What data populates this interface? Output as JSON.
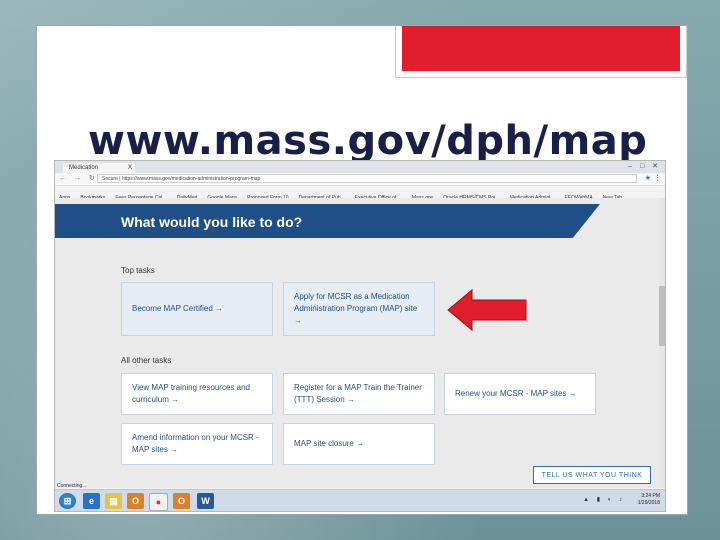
{
  "slide": {
    "title": "www.mass.gov/dph/map"
  },
  "browser": {
    "tab_title": "Medication Administrati...",
    "tab_close": "X",
    "window_controls": "– □ ✕",
    "nav_buttons": "← → ↻ ⌂",
    "url": "Secure | https://www.mass.gov/medication-administration-program-map",
    "bookmarks": [
      "Apps",
      "Bookmarks",
      "Fees Percentage Cal...",
      "DailyMed",
      "Google Maps",
      "Proposed Form 10",
      "Department of Pub...",
      "Executive Office of ...",
      "Mass.gov",
      "Oracle HRMS/CMS Por...",
      "Medication Admini...",
      "EEOWebMA",
      "New Tab"
    ],
    "status": "Connecting..."
  },
  "page": {
    "hero": "What would you like to do?",
    "top_tasks_label": "Top tasks",
    "top_tasks": [
      "Become MAP Certified →",
      "Apply for MCSR as a Medication Administration Program (MAP) site →"
    ],
    "other_tasks_label": "All other tasks",
    "other_tasks": [
      "View MAP training resources and curriculum →",
      "Register for a MAP Train the Trainer (TTT) Session →",
      "Renew your MCSR - MAP sites →",
      "Amend information on your MCSR - MAP sites →",
      "MAP site closure →"
    ],
    "feedback_button": "TELL US WHAT YOU THINK"
  },
  "taskbar": {
    "clock_time": "3:24 PM",
    "clock_date": "1/29/2018"
  },
  "colors": {
    "accent_red": "#e01e2d",
    "hero_blue": "#1f4f86",
    "title_navy": "#1a1f4a"
  }
}
